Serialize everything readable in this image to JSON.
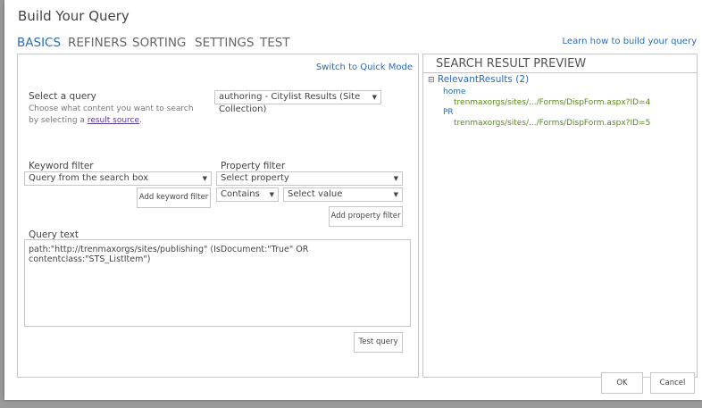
{
  "dialog": {
    "title": "Build Your Query",
    "learn_link": "Learn how to build your query"
  },
  "tabs": [
    {
      "label": "BASICS"
    },
    {
      "label": "REFINERS"
    },
    {
      "label": "SORTING"
    },
    {
      "label": "SETTINGS"
    },
    {
      "label": "TEST"
    }
  ],
  "basics": {
    "quick_mode_link": "Switch to Quick Mode",
    "select_query_label": "Select a query",
    "select_query_help": "Choose what content you want to search by selecting a",
    "result_source_link": "result source",
    "select_query_value": "authoring - Citylist Results (Site Collection)",
    "keyword_filter_label": "Keyword filter",
    "keyword_filter_value": "Query from the search box",
    "add_keyword_filter": "Add keyword filter",
    "property_filter_label": "Property filter",
    "property_value": "Select property",
    "operator_value": "Contains",
    "value_value": "Select value",
    "add_property_filter": "Add property filter",
    "query_text_label": "Query text",
    "query_text": "path:\"http://trenmaxorgs/sites/publishing\"  (IsDocument:\"True\" OR contentclass:\"STS_ListItem\")",
    "test_query": "Test query"
  },
  "preview": {
    "title": "SEARCH RESULT PREVIEW",
    "group": "RelevantResults (2)",
    "results": [
      {
        "title": "home",
        "url": "trenmaxorgs/sites/.../Forms/DispForm.aspx?ID=4"
      },
      {
        "title": "PR",
        "url": "trenmaxorgs/sites/.../Forms/DispForm.aspx?ID=5"
      }
    ]
  },
  "footer": {
    "ok": "OK",
    "cancel": "Cancel"
  }
}
